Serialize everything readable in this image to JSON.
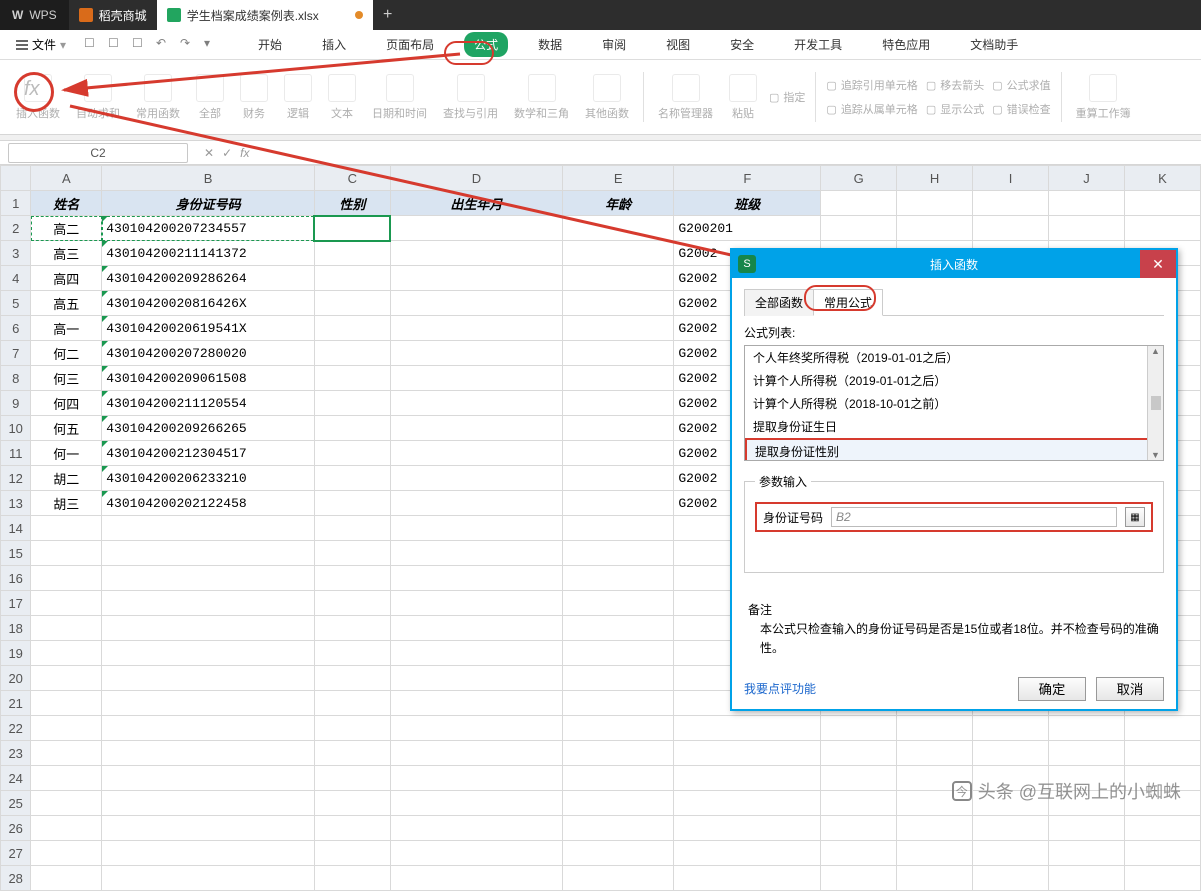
{
  "titlebar": {
    "app": "WPS",
    "tab_store": "稻壳商城",
    "tab_doc": "学生档案成绩案例表.xlsx"
  },
  "menu": {
    "file": "文件",
    "tabs": [
      "开始",
      "插入",
      "页面布局",
      "公式",
      "数据",
      "审阅",
      "视图",
      "安全",
      "开发工具",
      "特色应用",
      "文档助手"
    ],
    "active": 3
  },
  "ribbon": {
    "b0": "插入函数",
    "b1": "自动求和",
    "b2": "常用函数",
    "b3": "全部",
    "b4": "财务",
    "b5": "逻辑",
    "b6": "文本",
    "b7": "日期和时间",
    "b8": "查找与引用",
    "b9": "数学和三角",
    "b10": "其他函数",
    "b11": "名称管理器",
    "b12": "粘贴",
    "s1": "指定",
    "s2": "追踪引用单元格",
    "s3": "移去箭头",
    "s4": "公式求值",
    "s5": "追踪从属单元格",
    "s6": "显示公式",
    "s7": "错误检查",
    "s8": "重算工作簿"
  },
  "namebox": "C2",
  "columns": [
    "A",
    "B",
    "C",
    "D",
    "E",
    "F",
    "G",
    "H",
    "I",
    "J",
    "K"
  ],
  "headers": {
    "A": "姓名",
    "B": "身份证号码",
    "C": "性别",
    "D": "出生年月",
    "E": "年龄",
    "F": "班级"
  },
  "rows": [
    {
      "n": "高二",
      "id": "430104200207234557",
      "cls": "G200201"
    },
    {
      "n": "高三",
      "id": "430104200211141372",
      "cls": "G2002"
    },
    {
      "n": "高四",
      "id": "430104200209286264",
      "cls": "G2002"
    },
    {
      "n": "高五",
      "id": "43010420020816426X",
      "cls": "G2002"
    },
    {
      "n": "高一",
      "id": "43010420020619541X",
      "cls": "G2002"
    },
    {
      "n": "何二",
      "id": "430104200207280020",
      "cls": "G2002"
    },
    {
      "n": "何三",
      "id": "430104200209061508",
      "cls": "G2002"
    },
    {
      "n": "何四",
      "id": "430104200211120554",
      "cls": "G2002"
    },
    {
      "n": "何五",
      "id": "430104200209266265",
      "cls": "G2002"
    },
    {
      "n": "何一",
      "id": "430104200212304517",
      "cls": "G2002"
    },
    {
      "n": "胡二",
      "id": "430104200206233210",
      "cls": "G2002"
    },
    {
      "n": "胡三",
      "id": "430104200202122458",
      "cls": "G2002"
    }
  ],
  "dialog": {
    "title": "插入函数",
    "tab_all": "全部函数",
    "tab_common": "常用公式",
    "list_label": "公式列表:",
    "items": [
      "个人年终奖所得税（2019-01-01之后）",
      "计算个人所得税（2019-01-01之后）",
      "计算个人所得税（2018-10-01之前）",
      "提取身份证生日",
      "提取身份证性别"
    ],
    "param_legend": "参数输入",
    "param_label": "身份证号码",
    "param_value": "B2",
    "note_label": "备注",
    "note_text": "本公式只检查输入的身份证号码是否是15位或者18位。并不检查号码的准确性。",
    "feedback": "我要点评功能",
    "ok": "确定",
    "cancel": "取消"
  },
  "watermark": "头条 @互联网上的小蜘蛛"
}
